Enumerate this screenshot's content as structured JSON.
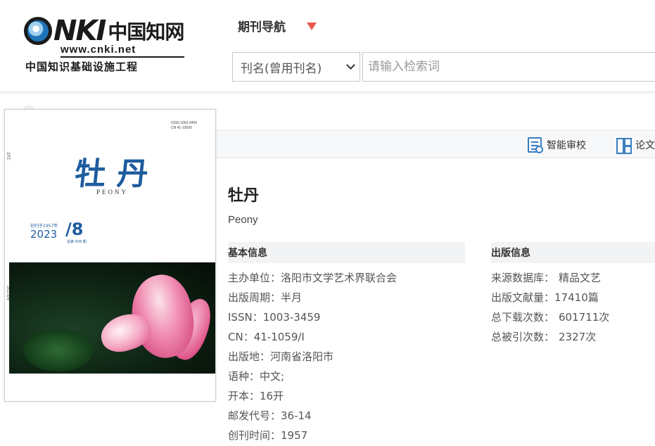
{
  "header": {
    "logo": {
      "brand_latin": "CNKI",
      "brand_cn": "中国知网",
      "url": "www.cnki.net",
      "slogan": "中国知识基础设施工程"
    },
    "nav_title": "期刊导航",
    "search": {
      "field_selected": "刊名(曾用刊名)",
      "placeholder": "请输入检索词"
    }
  },
  "toolbar": {
    "items": [
      {
        "label": "智能审校",
        "icon": "smart-review-icon"
      },
      {
        "label": "论文",
        "icon": "paper-icon"
      }
    ]
  },
  "cover": {
    "issn": "ISSN 1003-3459",
    "cn": "CN 41-1059/I",
    "title": "牡丹",
    "subtitle": "PEONY",
    "since": "创刊于1957年",
    "year": "2023",
    "issue": "8",
    "total": "总第 508 期",
    "colors": {
      "title": "#1f5c9e",
      "flower": "#e46b97",
      "background": "#0d2112"
    }
  },
  "journal": {
    "title": "牡丹",
    "english_title": "Peony",
    "basic_info": {
      "heading": "基本信息",
      "rows": [
        {
          "label": "主办单位：",
          "value": "洛阳市文学艺术界联合会"
        },
        {
          "label": "出版周期：",
          "value": "半月"
        },
        {
          "label": "ISSN：",
          "value": "1003-3459"
        },
        {
          "label": "CN：",
          "value": "41-1059/I"
        },
        {
          "label": "出版地：",
          "value": "河南省洛阳市"
        },
        {
          "label": "语种：",
          "value": "中文;"
        },
        {
          "label": "开本：",
          "value": "16开"
        },
        {
          "label": "邮发代号：",
          "value": "36-14"
        },
        {
          "label": "创刊时间：",
          "value": "1957"
        }
      ]
    },
    "pub_info": {
      "heading": "出版信息",
      "rows": [
        {
          "label": "来源数据库：",
          "value": "精品文艺"
        },
        {
          "label": "出版文献量：",
          "value": "17410篇"
        },
        {
          "label": "总下载次数：",
          "value": "601711次"
        },
        {
          "label": "总被引次数：",
          "value": "2327次"
        }
      ]
    }
  },
  "colors": {
    "accent": "#3a7fc1",
    "caret": "#e8594c"
  }
}
